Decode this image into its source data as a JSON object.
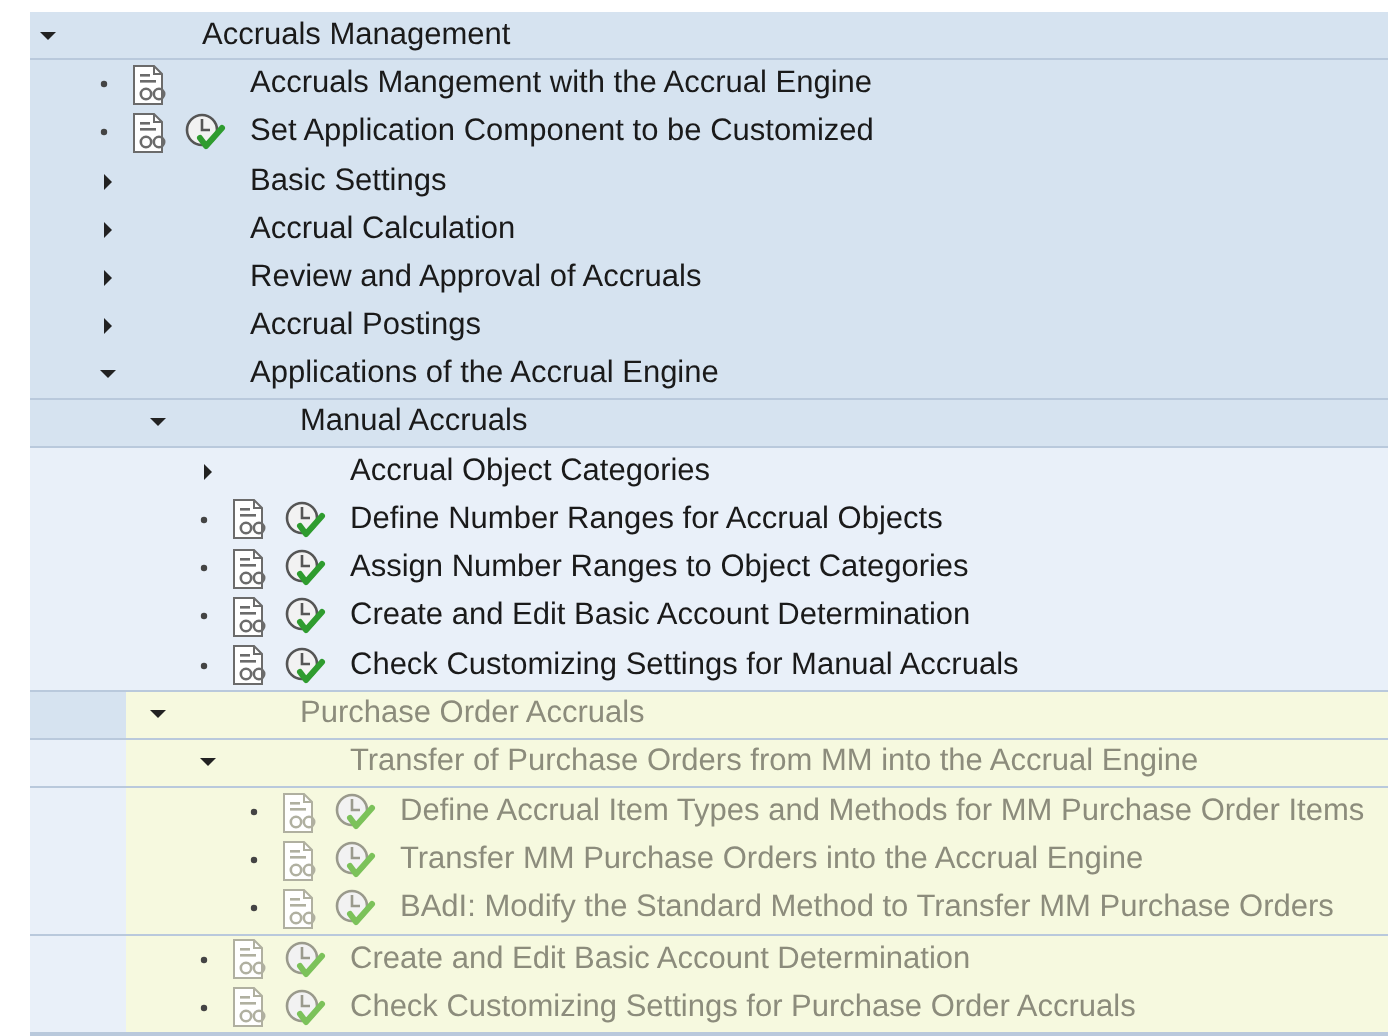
{
  "tree": [
    {
      "kind": "folder",
      "label": "Accruals Management",
      "expanded": true,
      "highlighted": false,
      "children": [
        {
          "kind": "activity",
          "label": "Accruals Mangement with the Accrual Engine",
          "documentation": true,
          "executable": false,
          "highlighted": false
        },
        {
          "kind": "activity",
          "label": "Set Application Component to be Customized",
          "documentation": true,
          "executable": true,
          "highlighted": false
        },
        {
          "kind": "folder",
          "label": "Basic Settings",
          "expanded": false,
          "highlighted": false
        },
        {
          "kind": "folder",
          "label": "Accrual Calculation",
          "expanded": false,
          "highlighted": false
        },
        {
          "kind": "folder",
          "label": "Review and Approval of Accruals",
          "expanded": false,
          "highlighted": false
        },
        {
          "kind": "folder",
          "label": "Accrual Postings",
          "expanded": false,
          "highlighted": false
        },
        {
          "kind": "folder",
          "label": "Applications of the Accrual Engine",
          "expanded": true,
          "highlighted": false,
          "children": [
            {
              "kind": "folder",
              "label": "Manual Accruals",
              "expanded": true,
              "highlighted": false,
              "children": [
                {
                  "kind": "folder",
                  "label": "Accrual Object Categories",
                  "expanded": false,
                  "highlighted": false
                },
                {
                  "kind": "activity",
                  "label": "Define Number Ranges for Accrual Objects",
                  "documentation": true,
                  "executable": true,
                  "highlighted": false
                },
                {
                  "kind": "activity",
                  "label": "Assign Number Ranges to Object Categories",
                  "documentation": true,
                  "executable": true,
                  "highlighted": false
                },
                {
                  "kind": "activity",
                  "label": "Create and Edit Basic Account Determination",
                  "documentation": true,
                  "executable": true,
                  "highlighted": false
                },
                {
                  "kind": "activity",
                  "label": "Check Customizing Settings for Manual Accruals",
                  "documentation": true,
                  "executable": true,
                  "highlighted": false
                }
              ]
            },
            {
              "kind": "folder",
              "label": "Purchase Order Accruals",
              "expanded": true,
              "highlighted": true,
              "children": [
                {
                  "kind": "folder",
                  "label": "Transfer of Purchase Orders from MM into the Accrual Engine",
                  "expanded": true,
                  "highlighted": true,
                  "children": [
                    {
                      "kind": "activity",
                      "label": "Define Accrual Item Types and Methods for MM Purchase Order Items",
                      "documentation": true,
                      "executable": true,
                      "highlighted": true
                    },
                    {
                      "kind": "activity",
                      "label": "Transfer MM Purchase Orders into the Accrual Engine",
                      "documentation": true,
                      "executable": true,
                      "highlighted": true
                    },
                    {
                      "kind": "activity",
                      "label": "BAdI: Modify the Standard Method to Transfer MM Purchase Orders",
                      "documentation": true,
                      "executable": true,
                      "highlighted": true
                    }
                  ]
                },
                {
                  "kind": "activity",
                  "label": "Create and Edit Basic Account Determination",
                  "documentation": true,
                  "executable": true,
                  "highlighted": true
                },
                {
                  "kind": "activity",
                  "label": "Check Customizing Settings for Purchase Order Accruals",
                  "documentation": true,
                  "executable": true,
                  "highlighted": true
                }
              ]
            }
          ]
        }
      ]
    }
  ]
}
